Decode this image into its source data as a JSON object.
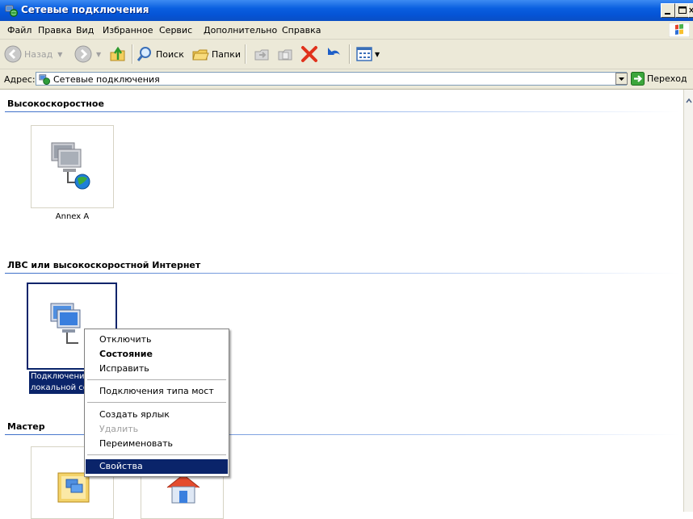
{
  "window": {
    "title": "Сетевые подключения"
  },
  "menu": [
    "Файл",
    "Правка",
    "Вид",
    "Избранное",
    "Сервис",
    "Дополнительно",
    "Справка"
  ],
  "toolbar": {
    "back": "Назад",
    "search": "Поиск",
    "folders": "Папки"
  },
  "address": {
    "label": "Адрес:",
    "value": "Сетевые подключения",
    "go": "Переход"
  },
  "groups": {
    "highspeed": {
      "header": "Высокоскоростное",
      "item_label": "Annex A"
    },
    "lan": {
      "header": "ЛВС или высокоскоростной Интернет",
      "item_label_line1": "Подключение по",
      "item_label_line2": "локальной сети"
    },
    "wizard": {
      "header": "Мастер"
    }
  },
  "context_menu": {
    "items": [
      "Отключить",
      "Состояние",
      "Исправить",
      "Подключения типа мост",
      "Создать ярлык",
      "Удалить",
      "Переименовать",
      "Свойства"
    ]
  },
  "colors": {
    "title_bar": "#0554d6",
    "selection": "#0a246a",
    "chrome": "#ece9d8"
  }
}
